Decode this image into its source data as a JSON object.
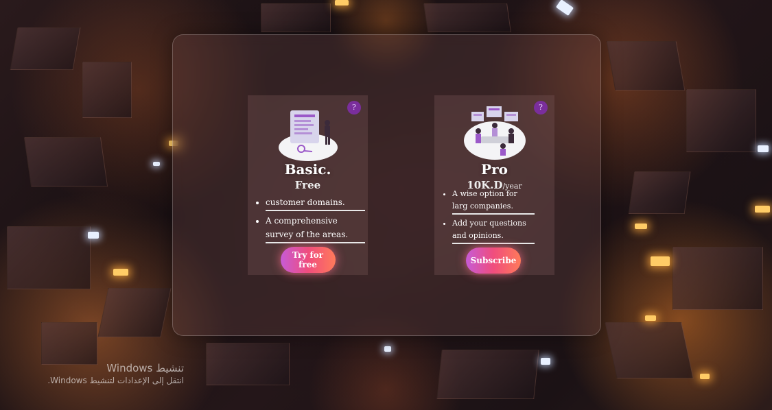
{
  "plans": [
    {
      "title": "Basic.",
      "price": "Free",
      "price_unit": "",
      "features": [
        "customer domains.",
        "A comprehensive survey of the areas."
      ],
      "cta": "Try for free",
      "badge_icon": "question-icon"
    },
    {
      "title": "Pro",
      "price": "10K.D",
      "price_unit": "/year",
      "features": [
        "A wise option for larg companies.",
        "Add your questions and opinions."
      ],
      "cta": "Subscribe",
      "badge_icon": "question-icon"
    }
  ],
  "os_watermark": {
    "line1": "تنشيط Windows",
    "line2": "انتقل إلى الإعدادات لتنشيط Windows."
  },
  "colors": {
    "button_gradient_start": "#c65bd6",
    "button_gradient_mid": "#f04d7d",
    "button_gradient_end": "#ff7a5a",
    "badge": "#7a2e9c",
    "divider": "#e8e8e8"
  }
}
